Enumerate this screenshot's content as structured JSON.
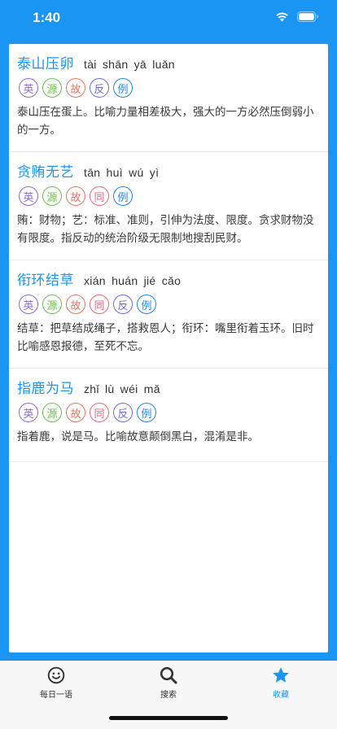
{
  "status_bar": {
    "time": "1:40"
  },
  "colors": {
    "accent": "#1a95f3",
    "tag_ying": "#8e6ad1",
    "tag_yuan": "#6fbf53",
    "tag_gu": "#e2765f",
    "tag_tong": "#e06a7a",
    "tag_fan": "#6b6fd3",
    "tag_li": "#1e86e8"
  },
  "entries": [
    {
      "title": "泰山压卵",
      "pinyin": "tài shān yā luǎn",
      "tags": [
        "英",
        "源",
        "故",
        "反",
        "例"
      ],
      "desc": "泰山压在蛋上。比喻力量相差极大，强大的一方必然压倒弱小的一方。"
    },
    {
      "title": "贪贿无艺",
      "pinyin": "tān huì wú yì",
      "tags": [
        "英",
        "源",
        "故",
        "同",
        "例"
      ],
      "desc": "贿：财物；艺：标准、准则，引伸为法度、限度。贪求财物没有限度。指反动的统治阶级无限制地搜刮民财。"
    },
    {
      "title": "衔环结草",
      "pinyin": "xián huán jié cǎo",
      "tags": [
        "英",
        "源",
        "故",
        "同",
        "反",
        "例"
      ],
      "desc": "结草：把草结成绳子，搭救恩人；衔环：嘴里衔着玉环。旧时比喻感恩报德，至死不忘。"
    },
    {
      "title": "指鹿为马",
      "pinyin": "zhǐ lù wéi mǎ",
      "tags": [
        "英",
        "源",
        "故",
        "同",
        "反",
        "例"
      ],
      "desc": "指着鹿，说是马。比喻故意颠倒黑白，混淆是非。"
    }
  ],
  "tab_bar": {
    "tabs": [
      {
        "label": "每日一语",
        "icon": "smiley-icon"
      },
      {
        "label": "搜索",
        "icon": "search-icon"
      },
      {
        "label": "收藏",
        "icon": "star-icon"
      }
    ],
    "active": 2
  }
}
